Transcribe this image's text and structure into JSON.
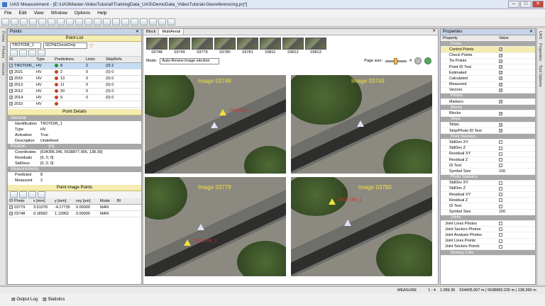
{
  "window": {
    "title": "UAS Measurement - [E:\\UASMaster-VideoTutorial\\TrainingData_UAS\\DemoData_VideoTutorial-Georeferencing.prj*]"
  },
  "menu": [
    "File",
    "Edit",
    "View",
    "Window",
    "Options",
    "Help"
  ],
  "left_tabs": [
    "Points",
    "Photos",
    "Vectors"
  ],
  "points_panel": {
    "title": "Points",
    "list_header": "Point List",
    "filter_value": "TROTOIR_1",
    "mode_value": "GCP&CheckOnly",
    "columns": [
      "ID",
      "Type",
      "Predictions",
      "Links",
      "StripRefs"
    ],
    "rows": [
      {
        "id": "TROTOIR_1",
        "type": "HV",
        "pred": "8",
        "links": "2",
        "strip": "(0) 2",
        "color": "#2a8a2a"
      },
      {
        "id": "2021",
        "type": "HV",
        "pred": "2",
        "links": "0",
        "strip": "(0) 0",
        "color": "#c84020"
      },
      {
        "id": "2015",
        "type": "HV",
        "pred": "13",
        "links": "0",
        "strip": "(0) 0",
        "color": "#c84020"
      },
      {
        "id": "2013",
        "type": "HV",
        "pred": "11",
        "links": "0",
        "strip": "(0) 0",
        "color": "#c84020"
      },
      {
        "id": "2012",
        "type": "HV",
        "pred": "20",
        "links": "0",
        "strip": "(0) 0",
        "color": "#c84020"
      },
      {
        "id": "2014",
        "type": "HV",
        "pred": "9",
        "links": "0",
        "strip": "(0) 0",
        "color": "#c84020"
      },
      {
        "id": "2010",
        "type": "HV",
        "pred": "",
        "links": "",
        "strip": "",
        "color": "#c84020"
      }
    ]
  },
  "point_details": {
    "title": "Point Details",
    "general_label": "General",
    "general": [
      {
        "k": "Identification",
        "v": "TROTOIR_1"
      },
      {
        "k": "Type",
        "v": "HV"
      },
      {
        "k": "Activation",
        "v": "True"
      },
      {
        "k": "Description",
        "v": "Undefined"
      }
    ],
    "position_label": "Position",
    "position_unit": "[m]",
    "position": [
      {
        "k": "Coordinates",
        "v": "[634396.346, 5638877.906, 138.39]"
      },
      {
        "k": "Residuals",
        "v": "[0, 0, 0]"
      },
      {
        "k": "StdDevs",
        "v": "[0, 0, 0]"
      }
    ],
    "meas_label": "Measurements",
    "meas": [
      {
        "k": "Predicted",
        "v": "8"
      },
      {
        "k": "Measured",
        "v": "2"
      }
    ]
  },
  "image_points": {
    "title": "Point Image Points",
    "columns": [
      "ID Photo",
      "x [mm]",
      "y [mm]",
      "vxy [um]",
      "Mode",
      "Bl"
    ],
    "rows": [
      {
        "photo": "03779",
        "x": "3.51078",
        "y": "-4.17735",
        "v": "0.00000",
        "mode": "MAN"
      },
      {
        "photo": "03748",
        "x": "0.18582",
        "y": "1.13962",
        "v": "0.00000",
        "mode": "MAN"
      }
    ]
  },
  "center": {
    "tabs": [
      "Block",
      "MultiAerial"
    ],
    "thumbnails": [
      "03748",
      "03749",
      "03779",
      "03780",
      "03781",
      "03811",
      "03812",
      "03813"
    ],
    "mode_label": "Mode:",
    "mode_value": "Auto-Renew image election",
    "page_size_label": "Page size:",
    "page_size_value": "4",
    "images": [
      {
        "label": "Image 03748",
        "point": "TROTOIR_1"
      },
      {
        "label": "Image 03749",
        "point": ""
      },
      {
        "label": "Image 03779",
        "point": "TROTOIR_1"
      },
      {
        "label": "Image 03780",
        "point": "TROTOIR_1"
      }
    ]
  },
  "properties": {
    "title": "Properties",
    "columns": [
      "Property",
      "Value"
    ],
    "rows": [
      {
        "k": "Points",
        "v": "",
        "kind": "sec"
      },
      {
        "k": "Control Points",
        "v": "x",
        "kind": "sel"
      },
      {
        "k": "Check Points",
        "v": "x",
        "kind": ""
      },
      {
        "k": "Tie Points",
        "v": "x",
        "kind": ""
      },
      {
        "k": "Point ID Text",
        "v": "x",
        "kind": ""
      },
      {
        "k": "Estimated",
        "v": "x",
        "kind": ""
      },
      {
        "k": "Calculated",
        "v": "x",
        "kind": ""
      },
      {
        "k": "Measured",
        "v": "x",
        "kind": ""
      },
      {
        "k": "Vectors",
        "v": "x",
        "kind": ""
      },
      {
        "k": "Photos",
        "v": "",
        "kind": "sec"
      },
      {
        "k": "Markers",
        "v": "x",
        "kind": ""
      },
      {
        "k": "Blocks",
        "v": "",
        "kind": "sec"
      },
      {
        "k": "Blocks",
        "v": "x",
        "kind": ""
      },
      {
        "k": "Strips",
        "v": "",
        "kind": "sec"
      },
      {
        "k": "Strips",
        "v": "x",
        "kind": ""
      },
      {
        "k": "Strip/Photo ID Text",
        "v": "x",
        "kind": ""
      },
      {
        "k": "Point Statistics",
        "v": "",
        "kind": "sec"
      },
      {
        "k": "StdDev XY",
        "v": "o",
        "kind": ""
      },
      {
        "k": "StdDev Z",
        "v": "o",
        "kind": ""
      },
      {
        "k": "Residual XY",
        "v": "o",
        "kind": ""
      },
      {
        "k": "Residual Z",
        "v": "o",
        "kind": ""
      },
      {
        "k": "ID Text",
        "v": "o",
        "kind": ""
      },
      {
        "k": "Symbol Size",
        "v": "100",
        "kind": ""
      },
      {
        "k": "Photo Statistics",
        "v": "",
        "kind": "sec"
      },
      {
        "k": "StdDev XY",
        "v": "o",
        "kind": ""
      },
      {
        "k": "StdDev Z",
        "v": "o",
        "kind": ""
      },
      {
        "k": "Residual XY",
        "v": "o",
        "kind": ""
      },
      {
        "k": "Residual Z",
        "v": "o",
        "kind": ""
      },
      {
        "k": "ID Text",
        "v": "o",
        "kind": ""
      },
      {
        "k": "Symbol Size",
        "v": "100",
        "kind": ""
      },
      {
        "k": "Joints",
        "v": "",
        "kind": "sec"
      },
      {
        "k": "Joint Lines Photos",
        "v": "o",
        "kind": "grp"
      },
      {
        "k": "Joint Sectors Photos",
        "v": "o",
        "kind": "grp"
      },
      {
        "k": "Joint Analysis Photos",
        "v": "o",
        "kind": "grp"
      },
      {
        "k": "Joint Lines Points",
        "v": "o",
        "kind": "grp"
      },
      {
        "k": "Joint Sectors Points",
        "v": "o",
        "kind": "grp"
      },
      {
        "k": "Binning Cells",
        "v": "",
        "kind": "sec"
      }
    ]
  },
  "right_tabs": [
    "UAS",
    "Properties",
    "Tool Options"
  ],
  "status": {
    "mode": "MEASURE",
    "scale": "1 : 4",
    "ratio": "1:289.36",
    "coords": "634405.007 m | 5638890.226 m | 138.390 m"
  },
  "bottom_tabs": [
    "Output Log",
    "Statistics"
  ]
}
